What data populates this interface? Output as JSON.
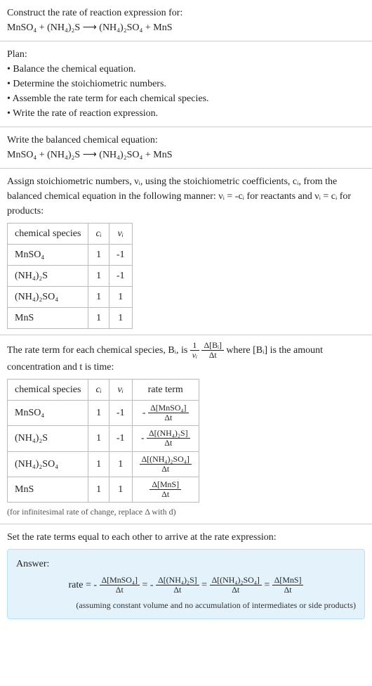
{
  "intro": {
    "construct": "Construct the rate of reaction expression for:",
    "equation": "MnSO₄ + (NH₄)₂S ⟶ (NH₄)₂SO₄ + MnS"
  },
  "plan": {
    "title": "Plan:",
    "items": [
      "Balance the chemical equation.",
      "Determine the stoichiometric numbers.",
      "Assemble the rate term for each chemical species.",
      "Write the rate of reaction expression."
    ]
  },
  "balanced": {
    "title": "Write the balanced chemical equation:",
    "equation": "MnSO₄ + (NH₄)₂S ⟶ (NH₄)₂SO₄ + MnS"
  },
  "stoich": {
    "intro": "Assign stoichiometric numbers, νᵢ, using the stoichiometric coefficients, cᵢ, from the balanced chemical equation in the following manner: νᵢ = -cᵢ for reactants and νᵢ = cᵢ for products:",
    "headers": {
      "species": "chemical species",
      "ci": "cᵢ",
      "vi": "νᵢ"
    },
    "rows": [
      {
        "species": "MnSO₄",
        "ci": "1",
        "vi": "-1"
      },
      {
        "species": "(NH₄)₂S",
        "ci": "1",
        "vi": "-1"
      },
      {
        "species": "(NH₄)₂SO₄",
        "ci": "1",
        "vi": "1"
      },
      {
        "species": "MnS",
        "ci": "1",
        "vi": "1"
      }
    ]
  },
  "rateterm": {
    "intro_pre": "The rate term for each chemical species, Bᵢ, is ",
    "intro_post": " where [Bᵢ] is the amount concentration and t is time:",
    "frac1_num": "1",
    "frac1_den": "νᵢ",
    "frac2_num": "Δ[Bᵢ]",
    "frac2_den": "Δt",
    "headers": {
      "species": "chemical species",
      "ci": "cᵢ",
      "vi": "νᵢ",
      "term": "rate term"
    },
    "rows": [
      {
        "species": "MnSO₄",
        "ci": "1",
        "vi": "-1",
        "neg": "-",
        "num": "Δ[MnSO₄]",
        "den": "Δt"
      },
      {
        "species": "(NH₄)₂S",
        "ci": "1",
        "vi": "-1",
        "neg": "-",
        "num": "Δ[(NH₄)₂S]",
        "den": "Δt"
      },
      {
        "species": "(NH₄)₂SO₄",
        "ci": "1",
        "vi": "1",
        "neg": "",
        "num": "Δ[(NH₄)₂SO₄]",
        "den": "Δt"
      },
      {
        "species": "MnS",
        "ci": "1",
        "vi": "1",
        "neg": "",
        "num": "Δ[MnS]",
        "den": "Δt"
      }
    ],
    "note": "(for infinitesimal rate of change, replace Δ with d)"
  },
  "final": {
    "title": "Set the rate terms equal to each other to arrive at the rate expression:",
    "answer_label": "Answer:",
    "rate_prefix": "rate = ",
    "eq": " = ",
    "terms": [
      {
        "neg": "-",
        "num": "Δ[MnSO₄]",
        "den": "Δt"
      },
      {
        "neg": "-",
        "num": "Δ[(NH₄)₂S]",
        "den": "Δt"
      },
      {
        "neg": "",
        "num": "Δ[(NH₄)₂SO₄]",
        "den": "Δt"
      },
      {
        "neg": "",
        "num": "Δ[MnS]",
        "den": "Δt"
      }
    ],
    "note": "(assuming constant volume and no accumulation of intermediates or side products)"
  }
}
